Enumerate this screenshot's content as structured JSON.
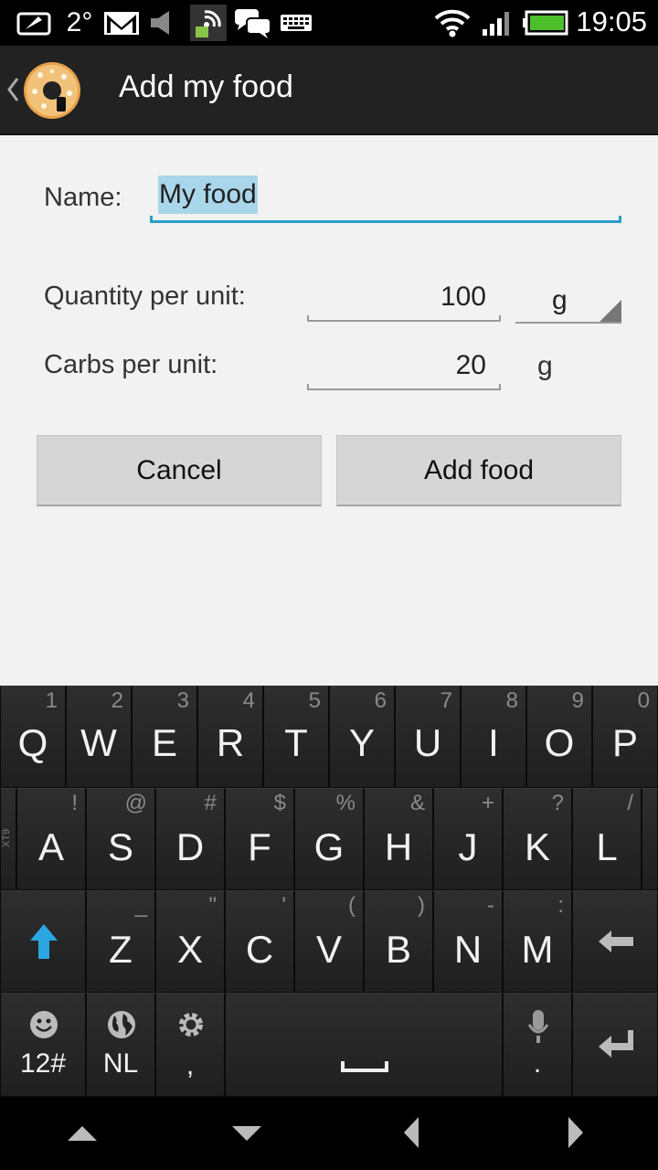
{
  "status_bar": {
    "time": "19:05",
    "temperature": "2°",
    "icons": [
      "screen-icon",
      "gmail-icon",
      "speaker-icon",
      "android-signal-icon",
      "chat-icon",
      "keyboard-icon",
      "wifi-icon",
      "signal-icon",
      "battery-icon"
    ]
  },
  "action_bar": {
    "title": "Add my food",
    "app_icon": "donut-icon"
  },
  "form": {
    "name_label": "Name:",
    "name_value": "My food",
    "quantity_label": "Quantity per unit:",
    "quantity_value": "100",
    "quantity_unit": "g",
    "carbs_label": "Carbs per unit:",
    "carbs_value": "20",
    "carbs_unit": "g"
  },
  "buttons": {
    "cancel": "Cancel",
    "add": "Add food"
  },
  "keyboard": {
    "row1": [
      {
        "main": "Q",
        "sub": "1"
      },
      {
        "main": "W",
        "sub": "2"
      },
      {
        "main": "E",
        "sub": "3"
      },
      {
        "main": "R",
        "sub": "4"
      },
      {
        "main": "T",
        "sub": "5"
      },
      {
        "main": "Y",
        "sub": "6"
      },
      {
        "main": "U",
        "sub": "7"
      },
      {
        "main": "I",
        "sub": "8"
      },
      {
        "main": "O",
        "sub": "9"
      },
      {
        "main": "P",
        "sub": "0"
      }
    ],
    "row2": [
      {
        "main": "A",
        "sub": "!"
      },
      {
        "main": "S",
        "sub": "@"
      },
      {
        "main": "D",
        "sub": "#"
      },
      {
        "main": "F",
        "sub": "$"
      },
      {
        "main": "G",
        "sub": "%"
      },
      {
        "main": "H",
        "sub": "&"
      },
      {
        "main": "J",
        "sub": "+"
      },
      {
        "main": "K",
        "sub": "?"
      },
      {
        "main": "L",
        "sub": "/"
      }
    ],
    "row3": [
      {
        "main": "Z",
        "sub": "_"
      },
      {
        "main": "X",
        "sub": "\""
      },
      {
        "main": "C",
        "sub": "'"
      },
      {
        "main": "V",
        "sub": "("
      },
      {
        "main": "B",
        "sub": ")"
      },
      {
        "main": "N",
        "sub": "-"
      },
      {
        "main": "M",
        "sub": ":"
      }
    ],
    "side_label": "XT9",
    "numeric_label": "12#",
    "language_label": "NL",
    "comma_label": ",",
    "period_label": "."
  },
  "colors": {
    "accent": "#2a9ec8",
    "selection": "#a9d6ea",
    "shift_arrow": "#2aa6e0"
  }
}
